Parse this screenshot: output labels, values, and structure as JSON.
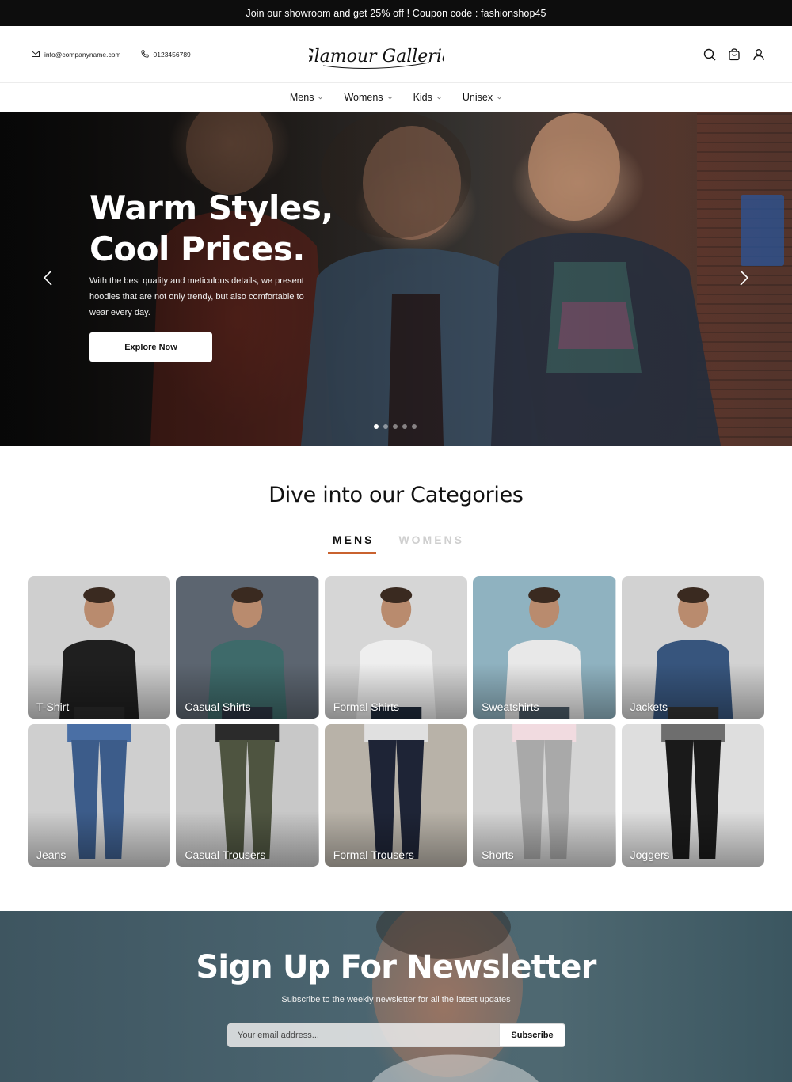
{
  "announcement": "Join our showroom and get 25% off ! Coupon code : fashionshop45",
  "header": {
    "email": "info@companyname.com",
    "phone": "0123456789",
    "logo_text": "Glamour Galleria",
    "icons": [
      "search-icon",
      "cart-icon",
      "user-icon"
    ]
  },
  "nav": {
    "items": [
      {
        "label": "Mens"
      },
      {
        "label": "Womens"
      },
      {
        "label": "Kids"
      },
      {
        "label": "Unisex"
      }
    ]
  },
  "hero": {
    "title_line1": "Warm Styles,",
    "title_line2": "Cool Prices.",
    "description": "With the best quality and meticulous details, we present hoodies that are not only trendy, but also comfortable to wear every day.",
    "cta": "Explore Now",
    "slides_total": 5,
    "active_slide": 1
  },
  "categories": {
    "title": "Dive into our Categories",
    "tabs": [
      {
        "label": "MENS",
        "active": true
      },
      {
        "label": "WOMENS",
        "active": false
      }
    ],
    "items": [
      {
        "label": "T-Shirt",
        "bg": "#cfcfcf",
        "top": "#1f1f1f",
        "bottom": "#2a2a2a"
      },
      {
        "label": "Casual Shirts",
        "bg": "#5c6570",
        "top": "#3e6a6a",
        "bottom": "#2c3442"
      },
      {
        "label": "Formal Shirts",
        "bg": "#d6d6d6",
        "top": "#eeeeee",
        "bottom": "#1f2a3a"
      },
      {
        "label": "Sweatshirts",
        "bg": "#8fb2c0",
        "top": "#e8e8e8",
        "bottom": "#4a5a66"
      },
      {
        "label": "Jackets",
        "bg": "#d2d2d2",
        "top": "#37557d",
        "bottom": "#333333"
      },
      {
        "label": "Jeans",
        "bg": "#cfcfcf",
        "top": "#4a6fa5",
        "bottom": "#3c5c8a"
      },
      {
        "label": "Casual Trousers",
        "bg": "#c8c8c8",
        "top": "#2b2b2b",
        "bottom": "#4e5440"
      },
      {
        "label": "Formal Trousers",
        "bg": "#b8b2a8",
        "top": "#e0e0e0",
        "bottom": "#1e2436"
      },
      {
        "label": "Shorts",
        "bg": "#d4d4d4",
        "top": "#f1dbe0",
        "bottom": "#a9a9a9"
      },
      {
        "label": "Joggers",
        "bg": "#dedede",
        "top": "#6e6e6e",
        "bottom": "#1a1a1a"
      }
    ]
  },
  "newsletter": {
    "title": "Sign Up For Newsletter",
    "subtitle": "Subscribe to the weekly newsletter for all the latest updates",
    "placeholder": "Your email address...",
    "button": "Subscribe"
  },
  "colors": {
    "accent": "#c9622f",
    "topbar": "#0d0d0d",
    "newsletter_bg": "#4b6570"
  }
}
